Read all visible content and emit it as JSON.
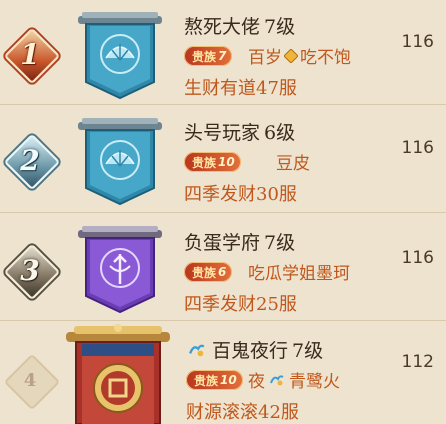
{
  "rows": [
    {
      "rank": "1",
      "name": "熬死大佬",
      "level": "7级",
      "noble_label": "贵族",
      "noble_level": "7",
      "friend_a": "百岁",
      "friend_b": "吃不饱",
      "guild": "生财有道47服",
      "score": "116",
      "banner_color": "#3e93b3"
    },
    {
      "rank": "2",
      "name": "头号玩家",
      "level": "6级",
      "noble_label": "贵族",
      "noble_level": "10",
      "friend_a": "豆皮",
      "friend_b": "",
      "guild": "四季发财30服",
      "score": "116",
      "banner_color": "#3e93b3"
    },
    {
      "rank": "3",
      "name": "负蛋学府",
      "level": "7级",
      "noble_label": "贵族",
      "noble_level": "6",
      "friend_a": "吃瓜学姐墨珂",
      "friend_b": "",
      "guild": "四季发财25服",
      "score": "116",
      "banner_color": "#7a4bc4"
    },
    {
      "rank": "4",
      "name": "百鬼夜行",
      "level": "7级",
      "noble_label": "贵族",
      "noble_level": "10",
      "friend_a": "夜",
      "friend_b": "青鹭火",
      "guild": "财源滚滚42服",
      "score": "112",
      "banner_color": "#b23a2a"
    }
  ]
}
